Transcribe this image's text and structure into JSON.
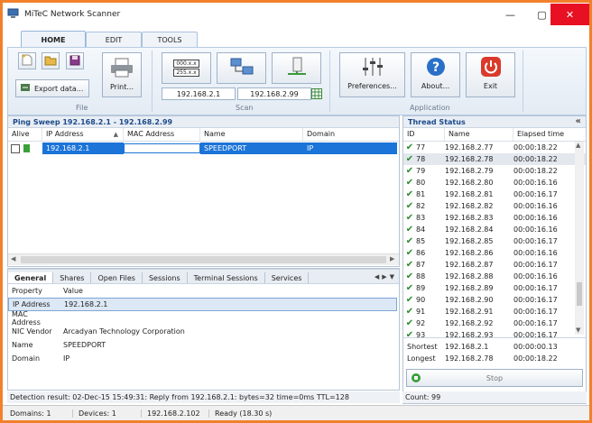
{
  "window": {
    "title": "MiTeC Network Scanner",
    "min": "—",
    "max": "▢",
    "close": "✕"
  },
  "ribbon": {
    "tabs": [
      "HOME",
      "EDIT",
      "TOOLS"
    ],
    "file_group": {
      "label": "File",
      "export_label": "Export data...",
      "print_label": "Print..."
    },
    "scan_group": {
      "label": "Scan",
      "from_ip": "192.168.2.1",
      "to_ip": "192.168.2.99",
      "icon_top_text": "000.x.x",
      "icon_bottom_text": "255.x.x"
    },
    "app_group": {
      "label": "Application",
      "preferences_label": "Preferences...",
      "about_label": "About...",
      "exit_label": "Exit"
    }
  },
  "ping_sweep": {
    "title": "Ping Sweep 192.168.2.1 - 192.168.2.99",
    "columns": [
      "Alive",
      "IP Address",
      "MAC Address",
      "Name",
      "Domain"
    ],
    "rows": [
      {
        "ip": "192.168.2.1",
        "mac": "",
        "name": "SPEEDPORT",
        "domain": "IP"
      }
    ]
  },
  "details": {
    "tabs": [
      "General",
      "Shares",
      "Open Files",
      "Sessions",
      "Terminal Sessions",
      "Services"
    ],
    "columns": [
      "Property",
      "Value"
    ],
    "rows": [
      {
        "property": "IP Address",
        "value": "192.168.2.1"
      },
      {
        "property": "MAC Address",
        "value": ""
      },
      {
        "property": "NIC Vendor",
        "value": "Arcadyan Technology Corporation"
      },
      {
        "property": "Name",
        "value": "SPEEDPORT"
      },
      {
        "property": "Domain",
        "value": "IP"
      }
    ]
  },
  "detection_result": "Detection result: 02-Dec-15 15:49:31: Reply from 192.168.2.1: bytes=32 time=0ms TTL=128",
  "statusbar": {
    "domains": "Domains: 1",
    "devices": "Devices: 1",
    "ip": "192.168.2.102",
    "ready": "Ready (18.30 s)"
  },
  "thread_status": {
    "title": "Thread Status",
    "collapse": "«",
    "columns": [
      "ID",
      "Name",
      "Elapsed time"
    ],
    "rows": [
      {
        "id": "77",
        "name": "192.168.2.77",
        "time": "00:00:18.22"
      },
      {
        "id": "78",
        "name": "192.168.2.78",
        "time": "00:00:18.22"
      },
      {
        "id": "79",
        "name": "192.168.2.79",
        "time": "00:00:18.22"
      },
      {
        "id": "80",
        "name": "192.168.2.80",
        "time": "00:00:16.16"
      },
      {
        "id": "81",
        "name": "192.168.2.81",
        "time": "00:00:16.17"
      },
      {
        "id": "82",
        "name": "192.168.2.82",
        "time": "00:00:16.16"
      },
      {
        "id": "83",
        "name": "192.168.2.83",
        "time": "00:00:16.16"
      },
      {
        "id": "84",
        "name": "192.168.2.84",
        "time": "00:00:16.16"
      },
      {
        "id": "85",
        "name": "192.168.2.85",
        "time": "00:00:16.17"
      },
      {
        "id": "86",
        "name": "192.168.2.86",
        "time": "00:00:16.16"
      },
      {
        "id": "87",
        "name": "192.168.2.87",
        "time": "00:00:16.17"
      },
      {
        "id": "88",
        "name": "192.168.2.88",
        "time": "00:00:16.16"
      },
      {
        "id": "89",
        "name": "192.168.2.89",
        "time": "00:00:16.17"
      },
      {
        "id": "90",
        "name": "192.168.2.90",
        "time": "00:00:16.17"
      },
      {
        "id": "91",
        "name": "192.168.2.91",
        "time": "00:00:16.17"
      },
      {
        "id": "92",
        "name": "192.168.2.92",
        "time": "00:00:16.17"
      },
      {
        "id": "93",
        "name": "192.168.2.93",
        "time": "00:00:16.17"
      }
    ],
    "shortest_label": "Shortest",
    "shortest_name": "192.168.2.1",
    "shortest_time": "00:00:00.13",
    "longest_label": "Longest",
    "longest_name": "192.168.2.78",
    "longest_time": "00:00:18.22",
    "stop_label": "Stop",
    "count": "Count: 99"
  },
  "colors": {
    "accent_border": "#f2802a",
    "selection": "#1b74d8",
    "check": "#2a8a2a",
    "exit_red": "#d93a2b"
  }
}
